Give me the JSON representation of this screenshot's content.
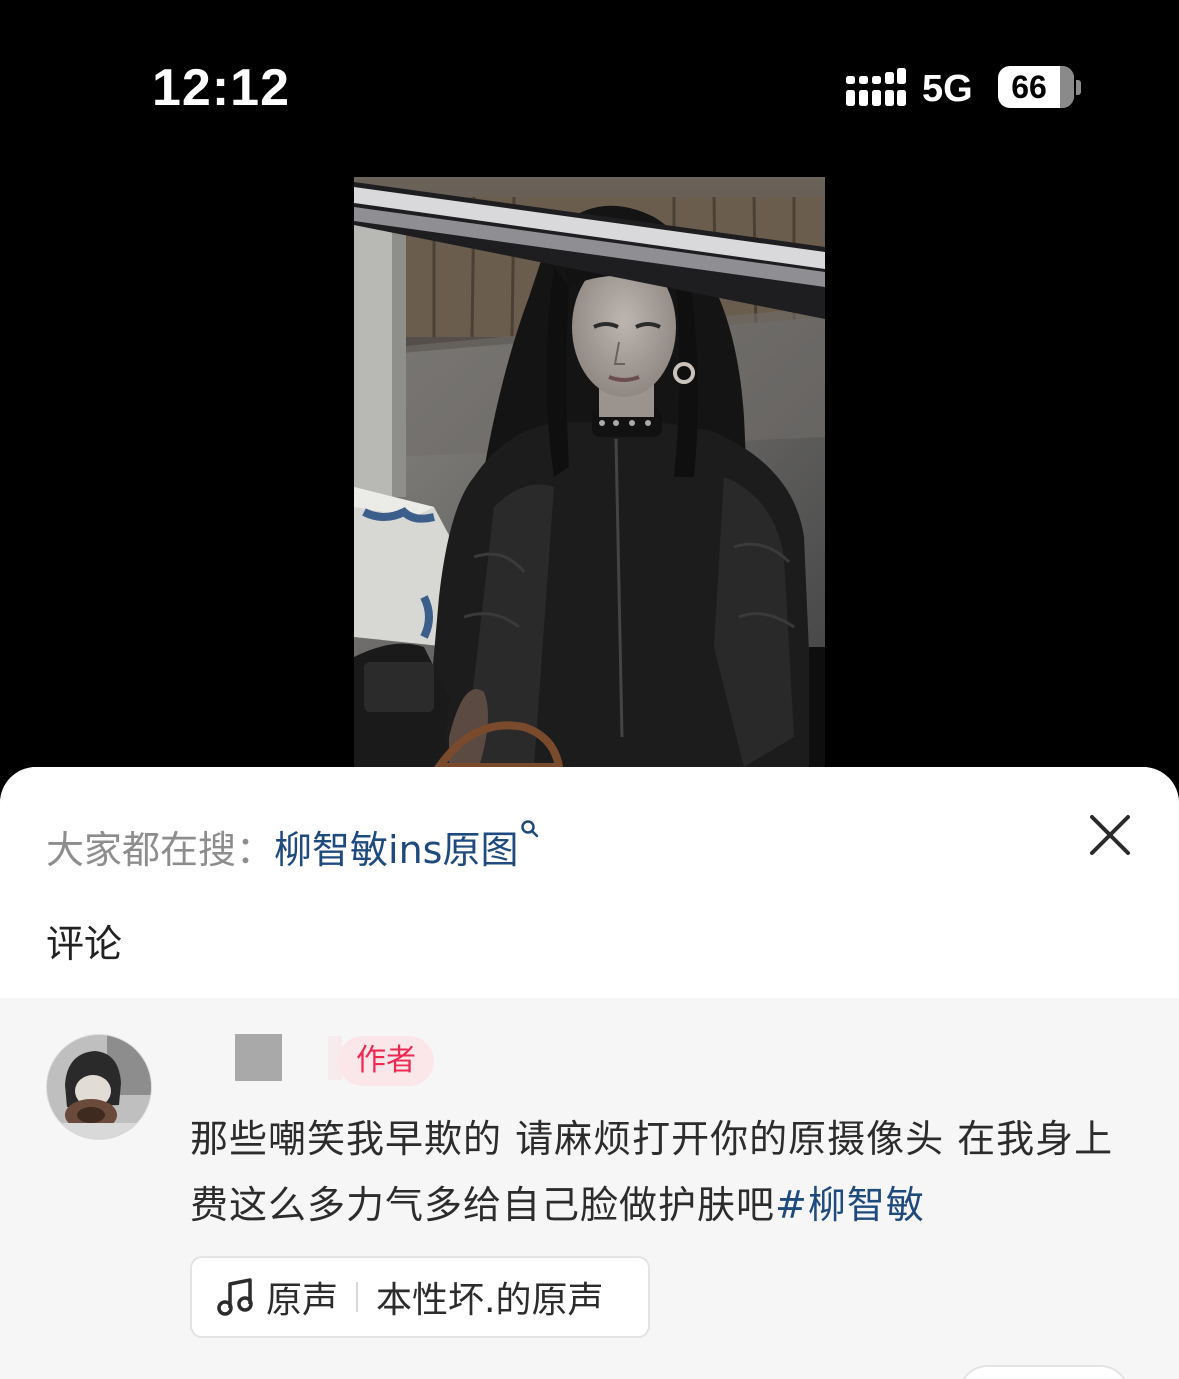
{
  "status_bar": {
    "time": "12:12",
    "network": "5G",
    "battery_level": "66"
  },
  "sheet": {
    "search_prefix": "大家都在搜：",
    "search_term": "柳智敏ins原图",
    "comments_title": "评论"
  },
  "comment": {
    "author_badge": "作者",
    "text": "那些嘲笑我早欺的 请麻烦打开你的原摄像头 在我身上费这么多力气多给自己脸做护肤吧",
    "hashtag": "#柳智敏",
    "music_label": "原声",
    "music_name": "本性坏.的原声"
  },
  "colors": {
    "link_blue": "#1f4a7e",
    "badge_red": "#ee2a52",
    "badge_bg": "#fbe6ea",
    "sheet_bg": "#f6f6f6"
  },
  "icons": [
    "signal-icon",
    "battery-icon",
    "search-icon",
    "close-icon",
    "music-note-icon"
  ]
}
